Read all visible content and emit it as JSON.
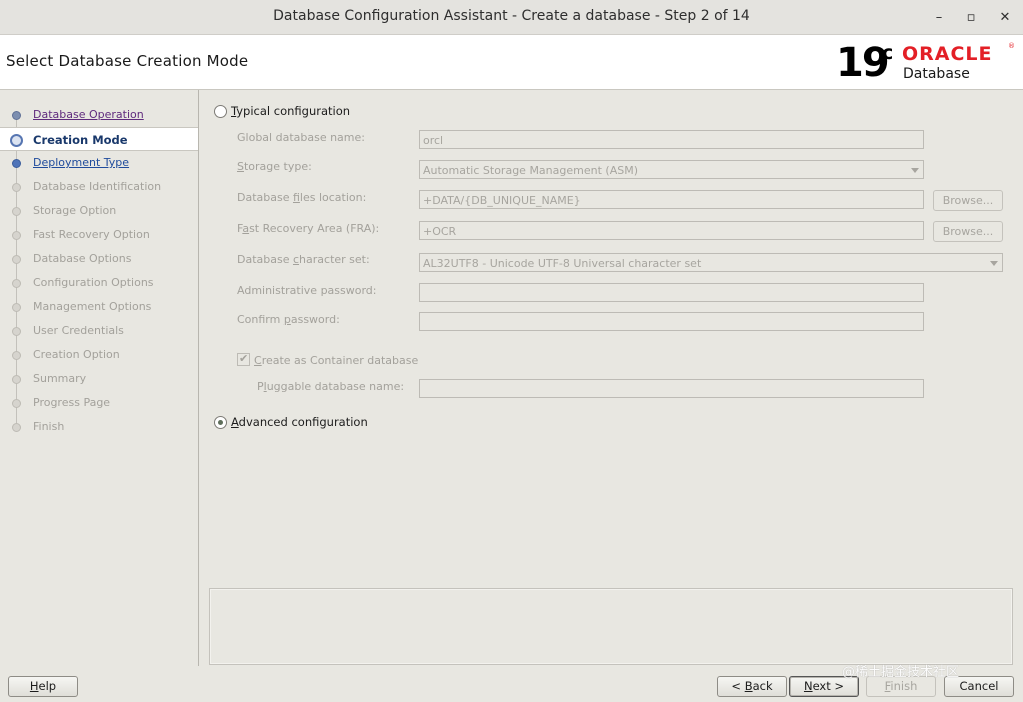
{
  "window": {
    "title": "Database Configuration Assistant - Create a database - Step 2 of 14",
    "minimize_glyph": "–",
    "maximize_glyph": "▫",
    "close_glyph": "✕"
  },
  "header": {
    "step_title": "Select Database Creation Mode",
    "logo": {
      "version": "19",
      "version_suffix": "c",
      "brand": "ORACLE",
      "reg_mark": "®",
      "product": "Database",
      "brand_color": "#e31f26"
    }
  },
  "sidebar": {
    "items": [
      {
        "label": "Database Operation",
        "state": "done"
      },
      {
        "label": "Creation Mode",
        "state": "current"
      },
      {
        "label": "Deployment Type",
        "state": "link"
      },
      {
        "label": "Database Identification",
        "state": "disabled"
      },
      {
        "label": "Storage Option",
        "state": "disabled"
      },
      {
        "label": "Fast Recovery Option",
        "state": "disabled"
      },
      {
        "label": "Database Options",
        "state": "disabled"
      },
      {
        "label": "Configuration Options",
        "state": "disabled"
      },
      {
        "label": "Management Options",
        "state": "disabled"
      },
      {
        "label": "User Credentials",
        "state": "disabled"
      },
      {
        "label": "Creation Option",
        "state": "disabled"
      },
      {
        "label": "Summary",
        "state": "disabled"
      },
      {
        "label": "Progress Page",
        "state": "disabled"
      },
      {
        "label": "Finish",
        "state": "disabled"
      }
    ]
  },
  "typical": {
    "mnemonic": "T",
    "label_rest": "ypical configuration",
    "selected": false,
    "fields": {
      "global_db_name": {
        "pre": "G",
        "mn": "",
        "label": "lobal database name:",
        "value": "orcl"
      },
      "storage_type": {
        "pre": "",
        "mn": "S",
        "label": "torage type:",
        "value": "Automatic Storage Management (ASM)"
      },
      "db_files_location": {
        "pre": "Database ",
        "mn": "f",
        "label": "iles location:",
        "value": "+DATA/{DB_UNIQUE_NAME}",
        "browse": "Browse..."
      },
      "fra": {
        "pre": "F",
        "mn": "a",
        "label": "st Recovery Area (FRA):",
        "value": "+OCR",
        "browse": "Browse..."
      },
      "charset": {
        "pre": "Database ",
        "mn": "c",
        "label": "haracter set:",
        "value": "AL32UTF8 - Unicode UTF-8 Universal character set"
      },
      "admin_password": {
        "pre": "Administrative password:",
        "mn": "",
        "label": "",
        "value": ""
      },
      "confirm_password": {
        "pre": "Confirm ",
        "mn": "p",
        "label": "assword:",
        "value": ""
      },
      "container": {
        "mn": "C",
        "label": "reate as Container database",
        "checked": true,
        "check_glyph": "✔"
      },
      "pdb_name": {
        "pre": "P",
        "mn": "l",
        "label": "uggable database name:",
        "value": ""
      }
    }
  },
  "advanced": {
    "mnemonic": "A",
    "label_rest": "dvanced configuration",
    "selected": true
  },
  "buttons": {
    "help": {
      "mn": "H",
      "label": "elp"
    },
    "back": {
      "pre": "< ",
      "mn": "B",
      "label": "ack"
    },
    "next": {
      "mn": "N",
      "label": "ext >"
    },
    "finish": {
      "mn": "F",
      "label": "inish"
    },
    "cancel": {
      "label": "Cancel"
    }
  },
  "watermark": "@稀土掘金技术社区"
}
